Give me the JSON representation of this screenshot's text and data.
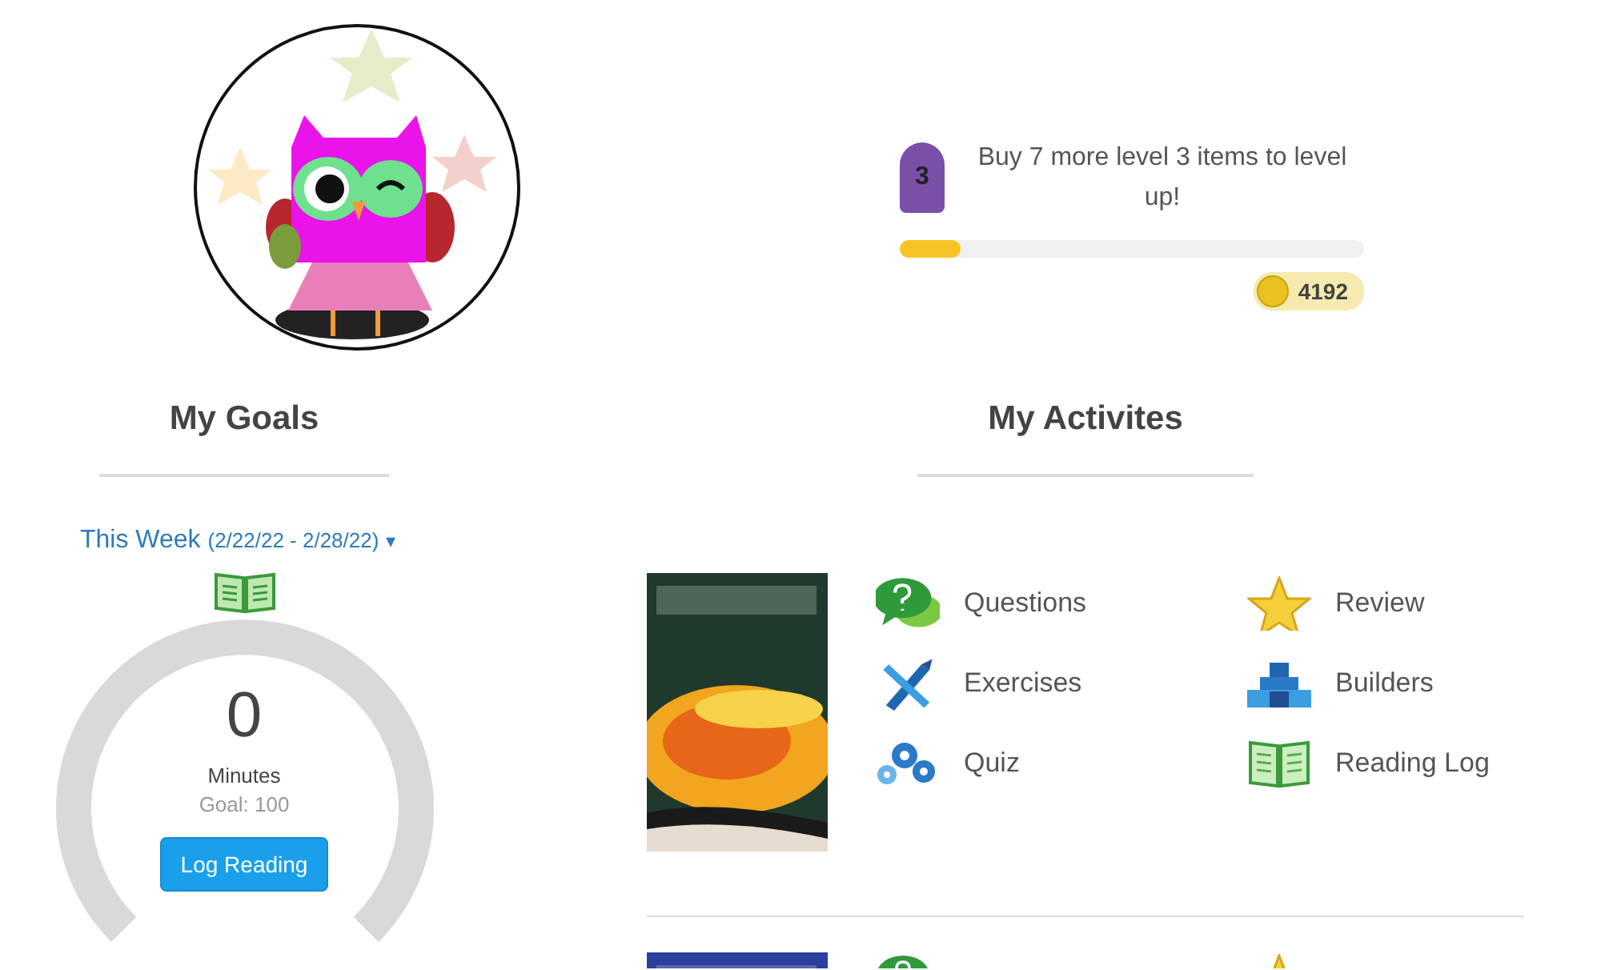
{
  "level": {
    "badge": "3",
    "message": "Buy 7 more level 3 items to level up!",
    "level": 0.13,
    "coins": "4192"
  },
  "goals": {
    "heading": "My Goals",
    "period": {
      "label": "This Week",
      "range": "(2/22/22 - 2/28/22)",
      "caret": "▾"
    },
    "gauge": {
      "value": "0",
      "unit": "Minutes",
      "goal": "Goal: 100"
    },
    "button": "Log Reading"
  },
  "activities": {
    "heading": "My Activites",
    "books": [
      {
        "items": [
          {
            "kind": "questions",
            "label": "Questions"
          },
          {
            "kind": "review",
            "label": "Review"
          },
          {
            "kind": "exercises",
            "label": "Exercises"
          },
          {
            "kind": "builders",
            "label": "Builders"
          },
          {
            "kind": "quiz",
            "label": "Quiz"
          },
          {
            "kind": "reading_log",
            "label": "Reading Log"
          }
        ]
      },
      {
        "items": [
          {
            "kind": "questions"
          },
          {
            "kind": "review"
          }
        ]
      }
    ]
  }
}
